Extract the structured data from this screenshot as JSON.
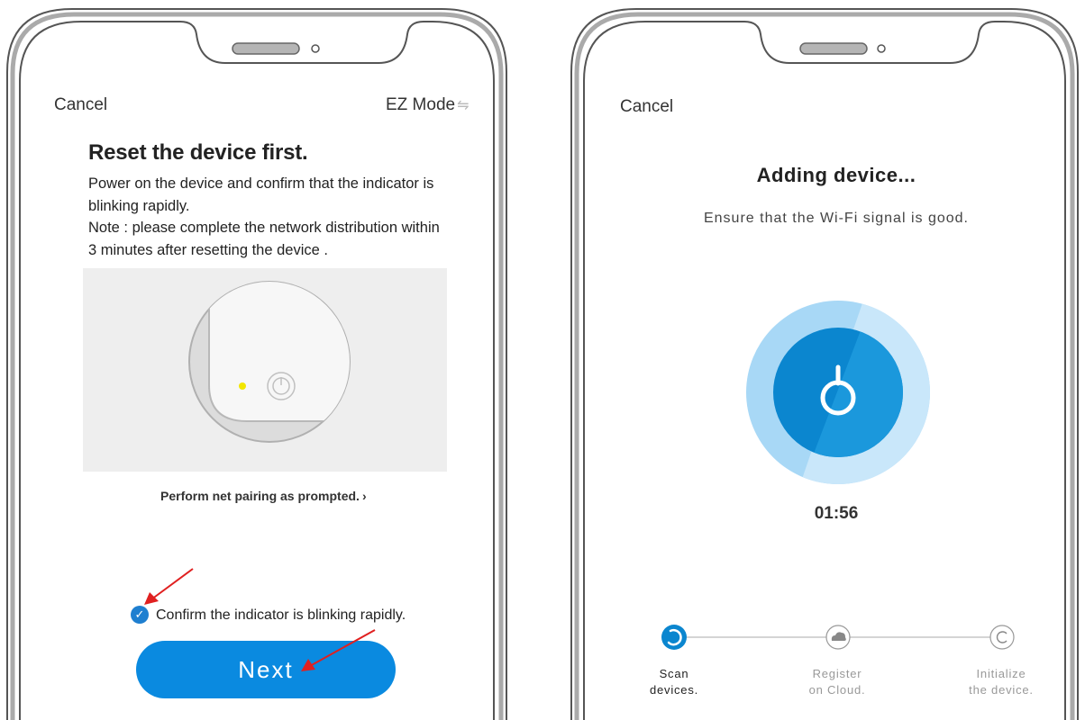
{
  "left": {
    "cancel_label": "Cancel",
    "mode_label": "EZ Mode",
    "mode_icon": "⇋",
    "title": "Reset the device first.",
    "instruction_lines": [
      "Power on the device and confirm that the indicator is",
      "blinking rapidly.",
      "Note : please complete the network distribution within",
      "3 minutes after resetting the device ."
    ],
    "pairing_link": "Perform net pairing as prompted.",
    "pairing_chevron": "›",
    "confirm_label": "Confirm the indicator is blinking rapidly.",
    "confirm_checked": true,
    "next_label": "Next",
    "accent_color": "#0a8ae0",
    "indicator_color": "#f2e600"
  },
  "right": {
    "cancel_label": "Cancel",
    "title": "Adding device...",
    "subtitle": "Ensure that the Wi-Fi signal is good.",
    "timer": "01:56",
    "steps": [
      {
        "line1": "Scan",
        "line2": "devices.",
        "state": "active",
        "icon": "spinner-icon"
      },
      {
        "line1": "Register",
        "line2": "on Cloud.",
        "state": "pending",
        "icon": "cloud-icon"
      },
      {
        "line1": "Initialize",
        "line2": "the device.",
        "state": "pending",
        "icon": "refresh-icon"
      }
    ],
    "ring_color": "#a8d8f6",
    "core_color": "#0b86cf"
  }
}
